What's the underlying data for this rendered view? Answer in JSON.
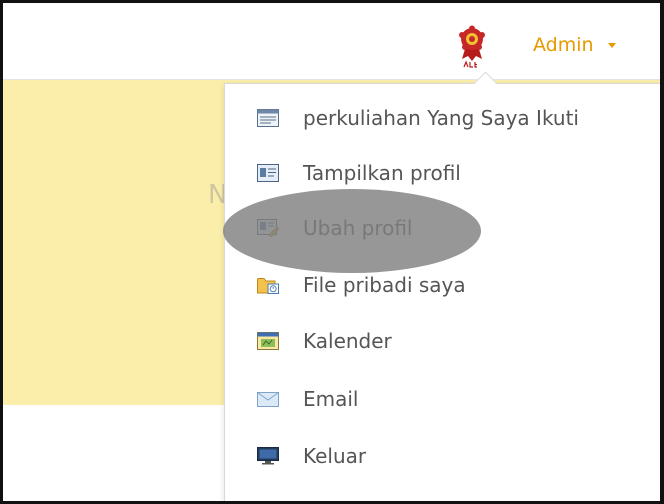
{
  "header": {
    "user_label": "Admin",
    "logo_icon": "university-crest-icon"
  },
  "alert": {
    "partial_text": "N"
  },
  "menu": {
    "items": [
      {
        "label": "perkuliahan Yang Saya Ikuti",
        "icon": "course-list-icon"
      },
      {
        "label": "Tampilkan profil",
        "icon": "id-card-icon"
      },
      {
        "label": "Ubah profil",
        "icon": "edit-profile-icon",
        "highlighted": true
      },
      {
        "label": "File pribadi saya",
        "icon": "folder-icon"
      },
      {
        "label": "Kalender",
        "icon": "calendar-icon"
      },
      {
        "label": "Email",
        "icon": "envelope-icon"
      },
      {
        "label": "Keluar",
        "icon": "logout-monitor-icon"
      }
    ]
  },
  "colors": {
    "accent": "#e69a00",
    "alert_bg": "#fbeeaa",
    "text": "#555555"
  }
}
